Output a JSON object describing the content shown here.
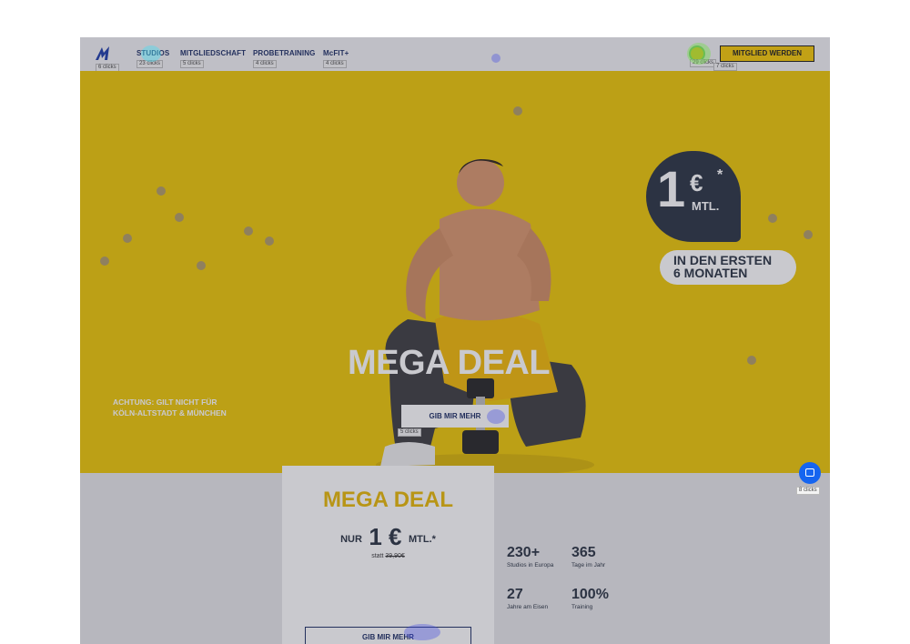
{
  "nav": {
    "logo_clicks": "6 clicks",
    "items": [
      {
        "label": "STUDIOS",
        "clicks": "23 clicks"
      },
      {
        "label": "MITGLIEDSCHAFT",
        "clicks": "5 clicks"
      },
      {
        "label": "PROBETRAINING",
        "clicks": "4 clicks"
      },
      {
        "label": "McFIT+",
        "clicks": "4 clicks"
      }
    ],
    "avatar_clicks": "29 clicks",
    "cta_clicks": "7 clicks",
    "cta_label": "MITGLIED WERDEN"
  },
  "hero": {
    "price_big": "1",
    "price_currency": "€",
    "price_asterisk": "*",
    "price_period": "MTL.",
    "months_line1": "IN DEN ERSTEN",
    "months_line2": "6 MONATEN",
    "title": "MEGA DEAL",
    "warning_line1": "ACHTUNG: GILT NICHT FÜR",
    "warning_line2": "KÖLN-ALTSTADT & MÜNCHEN",
    "button_label": "GIB MIR MEHR",
    "button_clicks": "5 clicks"
  },
  "deal_card": {
    "title": "MEGA DEAL",
    "prefix": "NUR",
    "amount": "1 €",
    "suffix": "MTL.*",
    "statt_label": "statt",
    "old_price": "39,90€",
    "button_label": "GIB MIR MEHR"
  },
  "stats": [
    {
      "value": "230+",
      "label": "Studios in Europa"
    },
    {
      "value": "365",
      "label": "Tage im Jahr"
    },
    {
      "value": "27",
      "label": "Jahre am Eisen"
    },
    {
      "value": "100%",
      "label": "Training"
    }
  ],
  "chat": {
    "clicks": "8 clicks"
  },
  "colors": {
    "brand_yellow": "#eec600",
    "navy": "#1a2b63",
    "dark": "#26303f",
    "heat": "#3c46e6"
  }
}
